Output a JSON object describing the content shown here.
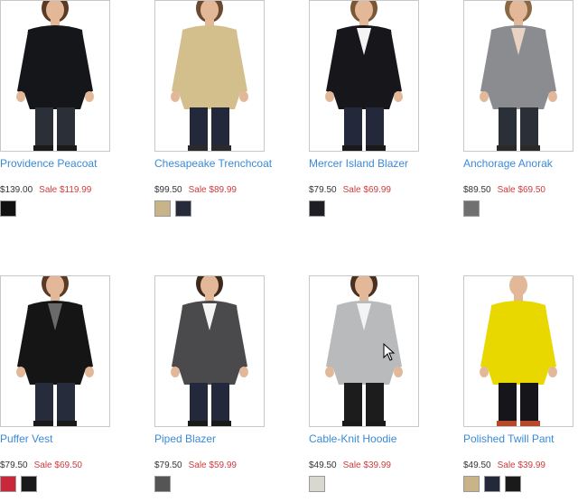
{
  "products": [
    {
      "name": "Providence Peacoat",
      "price": "$139.00",
      "sale": "Sale $119.99",
      "swatches": [
        "#111111"
      ],
      "image": {
        "skin": "#e3b898",
        "hair": "#5a3a24",
        "top": "#15161a",
        "bottom": "#2b2f38",
        "shoe": "#1a1a1a",
        "inner": "#15161a"
      }
    },
    {
      "name": "Chesapeake Trenchcoat",
      "price": "$99.50",
      "sale": "Sale $89.99",
      "swatches": [
        "#c9b48a",
        "#272a3a"
      ],
      "image": {
        "skin": "#e3b898",
        "hair": "#6a4a30",
        "top": "#d3bf8c",
        "bottom": "#23283a",
        "shoe": "#2a2a2a",
        "inner": "#d3bf8c"
      }
    },
    {
      "name": "Mercer Island Blazer",
      "price": "$79.50",
      "sale": "Sale $69.99",
      "swatches": [
        "#1e1e24"
      ],
      "image": {
        "skin": "#e3b898",
        "hair": "#7a5836",
        "top": "#17171b",
        "bottom": "#23283a",
        "shoe": "#1a1a1a",
        "inner": "#f4f4f4"
      }
    },
    {
      "name": "Anchorage Anorak",
      "price": "$89.50",
      "sale": "Sale $69.50",
      "swatches": [
        "#707070"
      ],
      "image": {
        "skin": "#e3b898",
        "hair": "#8a6a44",
        "top": "#8a8c8f",
        "bottom": "#2b2f38",
        "shoe": "#2a2a2a",
        "inner": "#e9d2c4"
      }
    },
    {
      "name": "Puffer Vest",
      "price": "$79.50",
      "sale": "Sale $69.50",
      "swatches": [
        "#c8283a",
        "#1a1a1a"
      ],
      "image": {
        "skin": "#e3b898",
        "hair": "#5a3a24",
        "top": "#151515",
        "bottom": "#262c3c",
        "shoe": "#1a1a1a",
        "inner": "#6a6a6a"
      }
    },
    {
      "name": "Piped Blazer",
      "price": "$79.50",
      "sale": "Sale $59.99",
      "swatches": [
        "#555555"
      ],
      "image": {
        "skin": "#e3b898",
        "hair": "#3e2a1c",
        "top": "#4a4a4c",
        "bottom": "#23283a",
        "shoe": "#1a1a1a",
        "inner": "#f4f4f4"
      }
    },
    {
      "name": "Cable-Knit Hoodie",
      "price": "$49.50",
      "sale": "Sale $39.99",
      "swatches": [
        "#d8d8d0"
      ],
      "image": {
        "skin": "#e3b898",
        "hair": "#4a3020",
        "top": "#b8babb",
        "bottom": "#1c1c1c",
        "shoe": "#1a1a1a",
        "inner": "#f4f4f4"
      }
    },
    {
      "name": "Polished Twill Pant",
      "price": "$49.50",
      "sale": "Sale $39.99",
      "swatches": [
        "#c9b48a",
        "#23283a",
        "#1a1a1a"
      ],
      "image": {
        "skin": "#e3b898",
        "hair": "#ffffff",
        "top": "#e8d800",
        "bottom": "#16161a",
        "shoe": "#b54a2a",
        "inner": "#e8d800"
      }
    }
  ]
}
